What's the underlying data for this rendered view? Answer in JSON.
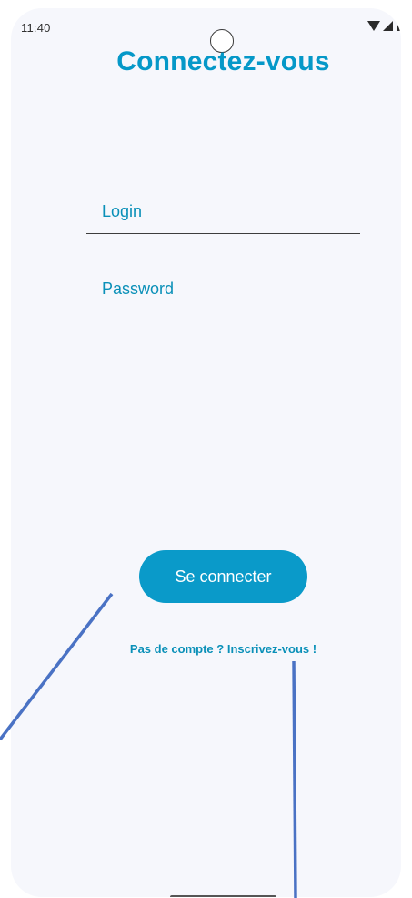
{
  "status_bar": {
    "time": "11:40",
    "icons": [
      "wifi-icon",
      "signal-icon",
      "battery-icon"
    ]
  },
  "page": {
    "title": "Connectez-vous"
  },
  "form": {
    "login_placeholder": "Login",
    "password_placeholder": "Password",
    "submit_label": "Se connecter"
  },
  "signup": {
    "link_text": "Pas de compte ? Inscrivez-vous !"
  },
  "colors": {
    "accent": "#0a9ac9",
    "background": "#f6f7fc",
    "annotation": "#4a72c4"
  }
}
